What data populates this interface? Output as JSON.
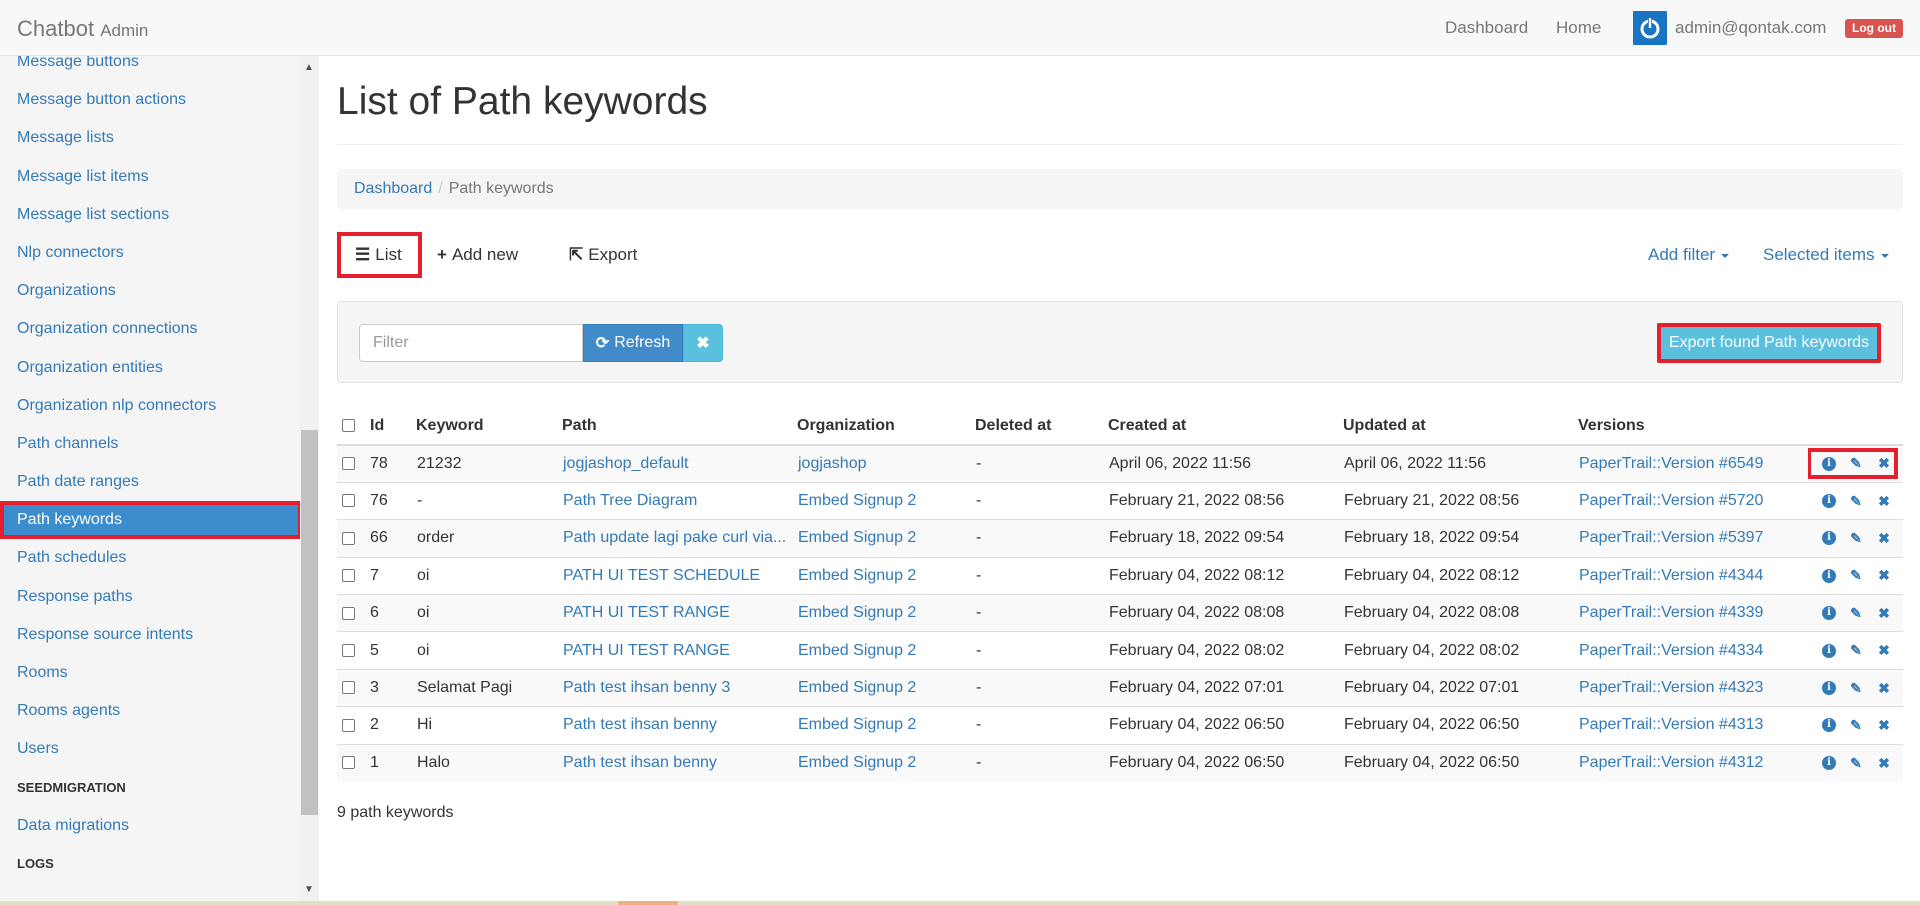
{
  "navbar": {
    "brand": "Chatbot",
    "brand_sub": "Admin",
    "links": [
      "Dashboard",
      "Home"
    ],
    "user_email": "admin@qontak.com",
    "logout_label": "Log out"
  },
  "sidebar": {
    "items": [
      "Message buttons",
      "Message button actions",
      "Message lists",
      "Message list items",
      "Message list sections",
      "Nlp connectors",
      "Organizations",
      "Organization connections",
      "Organization entities",
      "Organization nlp connectors",
      "Path channels",
      "Path date ranges",
      "Path keywords",
      "Path schedules",
      "Response paths",
      "Response source intents",
      "Rooms",
      "Rooms agents",
      "Users"
    ],
    "active_item": "Path keywords",
    "section_seed": "SEEDMIGRATION",
    "seed_items": [
      "Data migrations"
    ],
    "section_logs": "LOGS"
  },
  "page": {
    "title": "List of Path keywords",
    "breadcrumb_home": "Dashboard",
    "breadcrumb_current": "Path keywords"
  },
  "tabs": {
    "list": "List",
    "add_new": "Add new",
    "export": "Export",
    "add_filter": "Add filter",
    "selected_items": "Selected items"
  },
  "filter": {
    "placeholder": "Filter",
    "refresh_label": "Refresh",
    "export_found_label": "Export found Path keywords"
  },
  "table": {
    "headers": [
      "Id",
      "Keyword",
      "Path",
      "Organization",
      "Deleted at",
      "Created at",
      "Updated at",
      "Versions"
    ],
    "rows": [
      {
        "id": "78",
        "keyword": "21232",
        "path": "jogjashop_default",
        "organization": "jogjashop",
        "deleted_at": "-",
        "created_at": "April 06, 2022 11:56",
        "updated_at": "April 06, 2022 11:56",
        "version": "PaperTrail::Version #6549"
      },
      {
        "id": "76",
        "keyword": "-",
        "path": "Path Tree Diagram",
        "organization": "Embed Signup 2",
        "deleted_at": "-",
        "created_at": "February 21, 2022 08:56",
        "updated_at": "February 21, 2022 08:56",
        "version": "PaperTrail::Version #5720"
      },
      {
        "id": "66",
        "keyword": "order",
        "path": "Path update lagi pake curl via...",
        "organization": "Embed Signup 2",
        "deleted_at": "-",
        "created_at": "February 18, 2022 09:54",
        "updated_at": "February 18, 2022 09:54",
        "version": "PaperTrail::Version #5397"
      },
      {
        "id": "7",
        "keyword": "oi",
        "path": "PATH UI TEST SCHEDULE",
        "organization": "Embed Signup 2",
        "deleted_at": "-",
        "created_at": "February 04, 2022 08:12",
        "updated_at": "February 04, 2022 08:12",
        "version": "PaperTrail::Version #4344"
      },
      {
        "id": "6",
        "keyword": "oi",
        "path": "PATH UI TEST RANGE",
        "organization": "Embed Signup 2",
        "deleted_at": "-",
        "created_at": "February 04, 2022 08:08",
        "updated_at": "February 04, 2022 08:08",
        "version": "PaperTrail::Version #4339"
      },
      {
        "id": "5",
        "keyword": "oi",
        "path": "PATH UI TEST RANGE",
        "organization": "Embed Signup 2",
        "deleted_at": "-",
        "created_at": "February 04, 2022 08:02",
        "updated_at": "February 04, 2022 08:02",
        "version": "PaperTrail::Version #4334"
      },
      {
        "id": "3",
        "keyword": "Selamat Pagi",
        "path": "Path test ihsan benny 3",
        "organization": "Embed Signup 2",
        "deleted_at": "-",
        "created_at": "February 04, 2022 07:01",
        "updated_at": "February 04, 2022 07:01",
        "version": "PaperTrail::Version #4323"
      },
      {
        "id": "2",
        "keyword": "Hi",
        "path": "Path test ihsan benny",
        "organization": "Embed Signup 2",
        "deleted_at": "-",
        "created_at": "February 04, 2022 06:50",
        "updated_at": "February 04, 2022 06:50",
        "version": "PaperTrail::Version #4313"
      },
      {
        "id": "1",
        "keyword": "Halo",
        "path": "Path test ihsan benny",
        "organization": "Embed Signup 2",
        "deleted_at": "-",
        "created_at": "February 04, 2022 06:50",
        "updated_at": "February 04, 2022 06:50",
        "version": "PaperTrail::Version #4312"
      }
    ],
    "footer_count": "9 path keywords"
  },
  "colors": {
    "link": "#337ab7",
    "active_bg": "#3c8dce",
    "highlight": "#e4202e",
    "export_btn": "#5bc0de",
    "logout": "#d9534f"
  },
  "icons": {
    "list": "list-icon",
    "add": "plus-icon",
    "export": "share-icon",
    "refresh": "refresh-icon",
    "clear": "close-icon",
    "row_actions": [
      "info-icon",
      "pencil-icon",
      "delete-icon"
    ]
  }
}
